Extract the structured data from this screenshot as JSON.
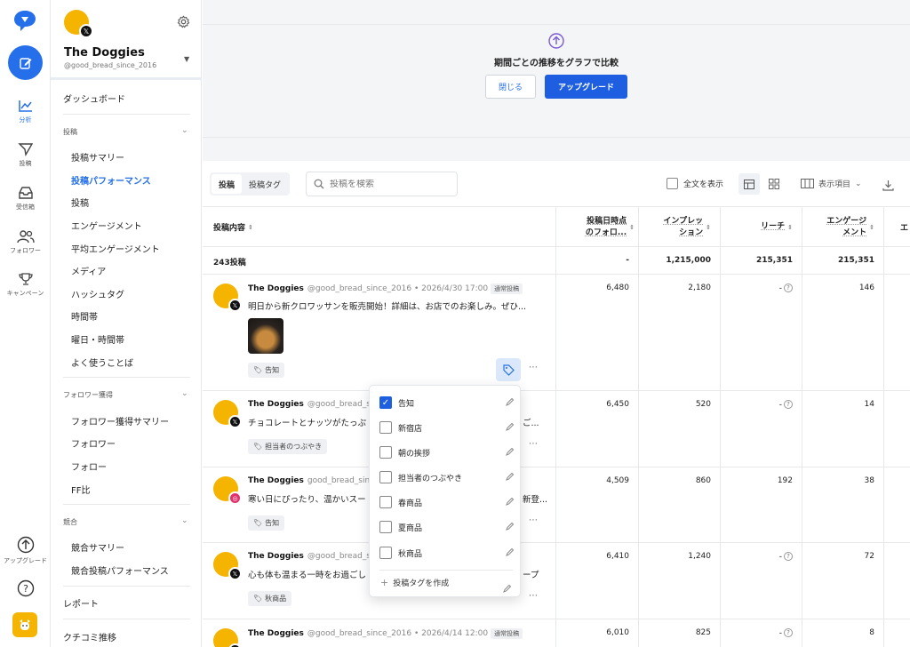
{
  "rail": {
    "items": [
      {
        "label": "分析"
      },
      {
        "label": "投稿"
      },
      {
        "label": "受信箱"
      },
      {
        "label": "フォロワー"
      },
      {
        "label": "キャンペーン"
      },
      {
        "label": "アップグレード"
      }
    ]
  },
  "account": {
    "name": "The Doggies",
    "handle": "@good_bread_since_2016"
  },
  "sidebar": {
    "dashboard": "ダッシュボード",
    "sec_posts": "投稿",
    "posts_items": [
      "投稿サマリー",
      "投稿パフォーマンス",
      "投稿",
      "エンゲージメント",
      "平均エンゲージメント",
      "メディア",
      "ハッシュタグ",
      "時間帯",
      "曜日・時間帯",
      "よく使うことば"
    ],
    "sec_followers": "フォロワー獲得",
    "follower_items": [
      "フォロワー獲得サマリー",
      "フォロワー",
      "フォロー",
      "FF比"
    ],
    "sec_competitors": "競合",
    "competitor_items": [
      "競合サマリー",
      "競合投稿パフォーマンス"
    ],
    "report": "レポート",
    "reviews": "クチコミ推移"
  },
  "promo": {
    "title": "期間ごとの推移をグラフで比較",
    "close": "閉じる",
    "upgrade": "アップグレード"
  },
  "toolbar": {
    "tabs": [
      "投稿",
      "投稿タグ"
    ],
    "search_placeholder": "投稿を検索",
    "fulltext": "全文を表示",
    "columns": "表示項目"
  },
  "table": {
    "headers": {
      "content": "投稿内容",
      "followers": [
        "投稿日時点",
        "のフォロ..."
      ],
      "impressions": [
        "インプレッ",
        "ション"
      ],
      "reach": "リーチ",
      "engagement": [
        "エンゲージ",
        "メント"
      ],
      "extra": "エ"
    },
    "total": {
      "label": "243投稿",
      "followers": "-",
      "impressions": "1,215,000",
      "reach": "215,351",
      "engagement": "215,351"
    },
    "rows": [
      {
        "name": "The Doggies",
        "handle": "@good_bread_since_2016",
        "date": "• 2026/4/30 17:00",
        "type": "通常投稿",
        "text": "明日から新クロワッサンを販売開始！詳細は、お店でのお楽しみ。ぜひ...",
        "tag": "告知",
        "followers": "6,480",
        "impressions": "2,180",
        "reach": "-",
        "engagement": "146"
      },
      {
        "name": "The Doggies",
        "handle": "@good_bread_since",
        "text": "チョコレートとナッツがたっぷ",
        "text_tail": "ご...",
        "tag": "担当者のつぶやき",
        "followers": "6,450",
        "impressions": "520",
        "reach": "-",
        "engagement": "14"
      },
      {
        "name": "The Doggies",
        "handle": "good_bread_since",
        "text": "寒い日にぴったり、温かいスー",
        "text_tail": "新登...",
        "tag": "告知",
        "followers": "4,509",
        "impressions": "860",
        "reach": "192",
        "engagement": "38"
      },
      {
        "name": "The Doggies",
        "handle": "@good_bread_since",
        "text": "心も体も温まる一時をお過ごし",
        "text_tail": "ープ",
        "tag": "秋商品",
        "followers": "6,410",
        "impressions": "1,240",
        "reach": "-",
        "engagement": "72"
      },
      {
        "name": "The Doggies",
        "handle": "@good_bread_since_2016",
        "date": "• 2026/4/14 12:00",
        "type": "通常投稿",
        "followers": "6,010",
        "impressions": "825",
        "reach": "-",
        "engagement": "8"
      }
    ]
  },
  "tag_dropdown": {
    "items": [
      {
        "label": "告知",
        "checked": true
      },
      {
        "label": "新宿店",
        "checked": false
      },
      {
        "label": "朝の挨拶",
        "checked": false
      },
      {
        "label": "担当者のつぶやき",
        "checked": false
      },
      {
        "label": "春商品",
        "checked": false
      },
      {
        "label": "夏商品",
        "checked": false
      },
      {
        "label": "秋商品",
        "checked": false
      }
    ],
    "create": "投稿タグを作成"
  },
  "colors": {
    "accent": "#2570ea",
    "brand_avatar": "#f5b400",
    "primary_button": "#1d5fe0"
  }
}
